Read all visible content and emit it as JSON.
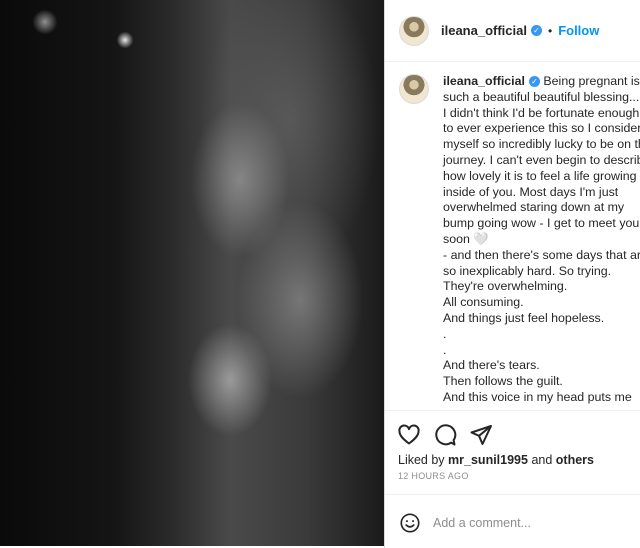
{
  "post": {
    "username": "ileana_official",
    "follow_label": "Follow",
    "separator": "•",
    "verified_mark": "✓"
  },
  "caption": {
    "username": "ileana_official",
    "lines": [
      "Being pregnant is",
      "such a beautiful beautiful blessing...",
      "I didn't think I'd be fortunate enough",
      "to ever experience this so I consider",
      "myself so incredibly lucky to be on this",
      "journey. I can't even begin to describe",
      "how lovely it is to feel a life growing",
      "inside of you. Most days I'm just",
      "overwhelmed staring down at my",
      "bump going wow - I get to meet you",
      "soon 🤍",
      "- and then there's some days that are",
      "so inexplicably hard. So trying.",
      "They're overwhelming.",
      "All consuming.",
      "And things just feel hopeless.",
      ".",
      ".",
      "And there's tears.",
      "Then follows the guilt.",
      "And this voice in my head puts me"
    ]
  },
  "actions": {
    "icons": [
      "heart-icon",
      "comment-icon",
      "share-icon"
    ],
    "liked_prefix": "Liked by",
    "liked_user": "mr_sunil1995",
    "liked_and": "and",
    "liked_others": "others",
    "timestamp": "12 HOURS AGO"
  },
  "comment": {
    "placeholder": "Add a comment...",
    "emoji_icon": "smiley-icon"
  },
  "colors": {
    "accent": "#0095f6",
    "verified": "#3897f0",
    "muted": "#8e8e8e",
    "text": "#262626"
  }
}
